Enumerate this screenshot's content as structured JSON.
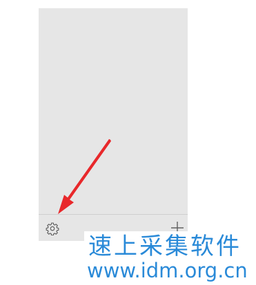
{
  "sidebar": {
    "footer": {
      "settings_icon": "gear-icon",
      "add_icon": "plus-icon"
    }
  },
  "annotation": {
    "type": "arrow",
    "color": "#e8282b",
    "points_to": "settings-button"
  },
  "watermark": {
    "brand": "速上采集软件",
    "url": "www.idm.org.cn",
    "color": "#2a8ad8"
  },
  "colors": {
    "panel_background": "#e6e6e6",
    "divider": "#cfcfcf",
    "icon": "#606060"
  }
}
